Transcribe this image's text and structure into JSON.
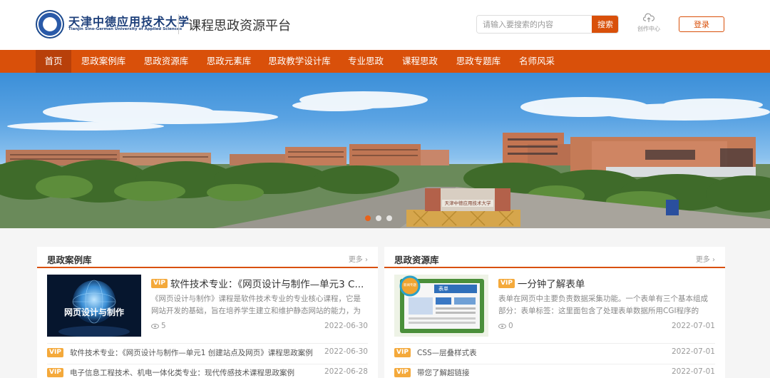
{
  "header": {
    "logo_cn": "天津中德应用技术大学",
    "logo_en": "Tianjin Sino-German University of Applied Sciences",
    "site_title": "课程思政资源平台",
    "search_placeholder": "请输入要搜索的内容",
    "search_button": "搜索",
    "creator_label": "创作中心",
    "login_button": "登录"
  },
  "nav": {
    "items": [
      "首页",
      "思政案例库",
      "思政资源库",
      "思政元素库",
      "思政教学设计库",
      "专业思政",
      "课程思政",
      "思政专题库",
      "名师风采"
    ],
    "active_index": 0
  },
  "banner": {
    "gate_sign": "天津中德应用技术大学",
    "slide_count": 3,
    "active_slide": 0
  },
  "left_panel": {
    "title": "思政案例库",
    "more": "更多",
    "feature": {
      "thumb_text": "网页设计与制作",
      "vip": "VIP",
      "title": "软件技术专业：《网页设计与制作—单元3 C...",
      "desc": "《网页设计与制作》课程是软件技术专业的专业核心课程，它是网站开发的基础，旨在培养学生建立和维护静态网站的能力，为后...",
      "views": "5",
      "date": "2022-06-30"
    },
    "rows": [
      {
        "vip": "VIP",
        "text": "软件技术专业：《网页设计与制作—单元1 创建站点及网页》课程思政案例",
        "date": "2022-06-30"
      },
      {
        "vip": "VIP",
        "text": "电子信息工程技术、机电一体化类专业：现代传感技术课程思政案例",
        "date": "2022-06-28"
      }
    ]
  },
  "right_panel": {
    "title": "思政资源库",
    "more": "更多",
    "feature": {
      "thumb_badge": "新闻专题",
      "thumb_tab": "表单",
      "vip": "VIP",
      "title": "一分钟了解表单",
      "desc": "表单在网页中主要负责数据采集功能。一个表单有三个基本组成部分：表单标签：这里面包含了处理表单数据所用CGI程序的URL...",
      "views": "0",
      "date": "2022-07-01"
    },
    "rows": [
      {
        "vip": "VIP",
        "text": "CSS—层叠样式表",
        "date": "2022-07-01"
      },
      {
        "vip": "VIP",
        "text": "带您了解超链接",
        "date": "2022-07-01"
      }
    ]
  },
  "colors": {
    "brand": "#d9500a",
    "nav_active": "#b8400a",
    "vip": "#f4a93b"
  }
}
